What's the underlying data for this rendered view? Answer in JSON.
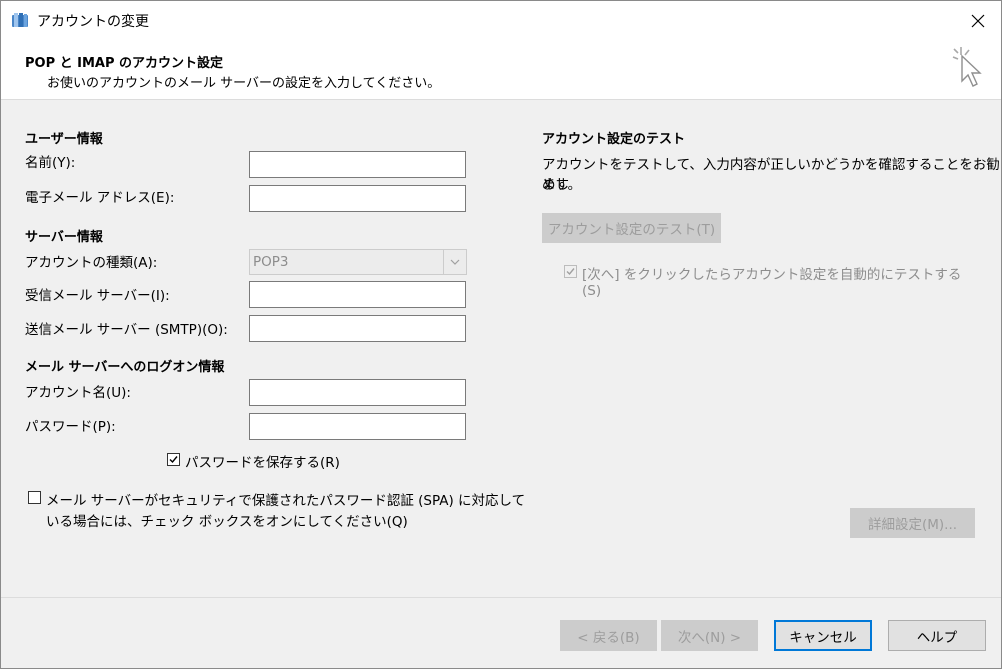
{
  "window": {
    "title": "アカウントの変更",
    "close_glyph": "✕"
  },
  "header": {
    "title": "POP と IMAP のアカウント設定",
    "subtitle": "お使いのアカウントのメール サーバーの設定を入力してください。"
  },
  "user_info": {
    "heading": "ユーザー情報",
    "name_label": "名前(Y):",
    "name_value": "",
    "email_label": "電子メール アドレス(E):",
    "email_value": ""
  },
  "server_info": {
    "heading": "サーバー情報",
    "account_type_label": "アカウントの種類(A):",
    "account_type_value": "POP3",
    "incoming_label": "受信メール サーバー(I):",
    "incoming_value": "",
    "outgoing_label": "送信メール サーバー (SMTP)(O):",
    "outgoing_value": ""
  },
  "logon_info": {
    "heading": "メール サーバーへのログオン情報",
    "account_name_label": "アカウント名(U):",
    "account_name_value": "",
    "password_label": "パスワード(P):",
    "password_value": "",
    "save_password_label": "パスワードを保存する(R)",
    "save_password_checked": true,
    "spa_label_line1": "メール サーバーがセキュリティで保護されたパスワード認証 (SPA) に対応して",
    "spa_label_line2": "いる場合には、チェック ボックスをオンにしてください(Q)",
    "spa_checked": false
  },
  "test_settings": {
    "heading": "アカウント設定のテスト",
    "description_line1": "アカウントをテストして、入力内容が正しいかどうかを確認することをお勧めし",
    "description_line2": "ます。",
    "test_button": "アカウント設定のテスト(T)",
    "auto_test_line1": "[次へ] をクリックしたらアカウント設定を自動的にテストする",
    "auto_test_line2": "(S)",
    "auto_test_checked": true
  },
  "more_settings_button": "詳細設定(M)...",
  "footer": {
    "back": "< 戻る(B)",
    "next": "次へ(N) >",
    "cancel": "キャンセル",
    "help": "ヘルプ"
  },
  "colors": {
    "accent": "#0078d7",
    "disabled_text": "#9d9d9d"
  }
}
